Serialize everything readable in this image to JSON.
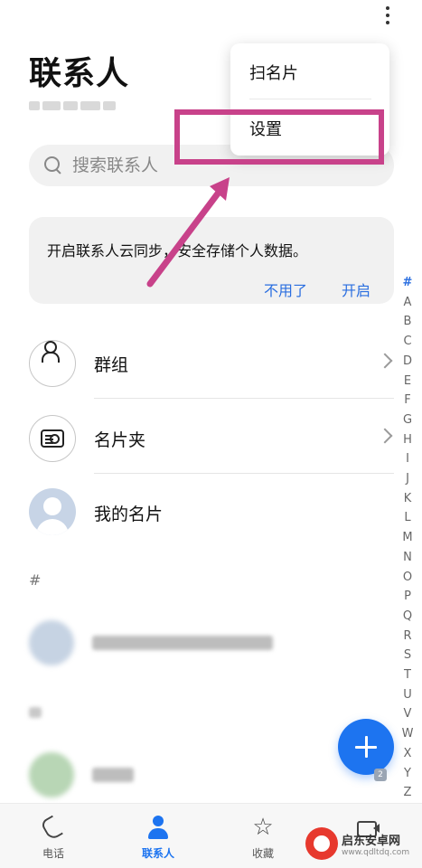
{
  "header": {
    "title": "联系人",
    "more_icon": "more-vertical-icon"
  },
  "search": {
    "placeholder": "搜索联系人",
    "icon": "search-icon"
  },
  "sync_card": {
    "text": "开启联系人云同步，安全存储个人数据。",
    "decline_label": "不用了",
    "accept_label": "开启"
  },
  "rows": [
    {
      "label": "群组",
      "icon": "group-icon"
    },
    {
      "label": "名片夹",
      "icon": "business-card-icon"
    },
    {
      "label": "我的名片",
      "icon": "avatar"
    }
  ],
  "contacts_section": {
    "letter": "#"
  },
  "alphabet_index": [
    "#",
    "A",
    "B",
    "C",
    "D",
    "E",
    "F",
    "G",
    "H",
    "I",
    "J",
    "K",
    "L",
    "M",
    "N",
    "O",
    "P",
    "Q",
    "R",
    "S",
    "T",
    "U",
    "V",
    "W",
    "X",
    "Y",
    "Z"
  ],
  "fab": {
    "icon": "plus-icon",
    "badge": "2"
  },
  "bottom_nav": [
    {
      "label": "电话",
      "icon": "phone-icon",
      "active": false
    },
    {
      "label": "联系人",
      "icon": "contacts-icon",
      "active": true
    },
    {
      "label": "收藏",
      "icon": "star-icon",
      "active": false
    },
    {
      "label": "",
      "icon": "video-icon",
      "active": false
    }
  ],
  "popup_menu": {
    "items": [
      {
        "label": "扫名片"
      },
      {
        "label": "设置"
      }
    ]
  },
  "watermark": {
    "name": "启东安卓网",
    "url": "www.qdltdq.com"
  },
  "colors": {
    "accent": "#1d74f0",
    "link": "#2a6ee0",
    "highlight_annotation": "#c8428a"
  }
}
